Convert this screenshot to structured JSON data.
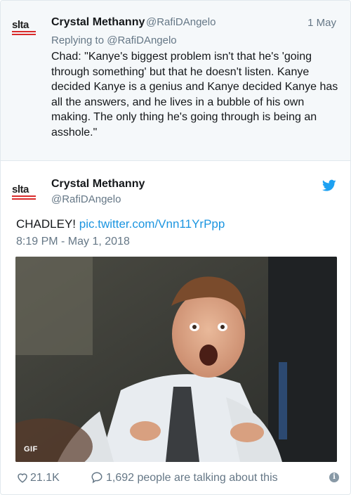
{
  "parent_tweet": {
    "avatar_text": "slta",
    "name": "Crystal Methanny",
    "handle": "@RafiDAngelo",
    "date": "1 May",
    "replying_to": "Replying to @RafiDAngelo",
    "text": "Chad: \"Kanye's biggest problem isn't that he's 'going through something' but that he doesn't listen. Kanye decided Kanye is a genius and Kanye decided Kanye has all the answers, and he lives in a bubble of his own making. The only thing he's going through is being an asshole.\""
  },
  "main_tweet": {
    "avatar_text": "slta",
    "name": "Crystal Methanny",
    "handle": "@RafiDAngelo",
    "text": "CHADLEY!",
    "link": "pic.twitter.com/Vnn11YrPpp",
    "timestamp": "8:19 PM - May 1, 2018",
    "media_badge": "GIF",
    "bird_icon": "twitter-bird-icon"
  },
  "footer": {
    "likes": "21.1K",
    "talking": "1,692 people are talking about this",
    "info_glyph": "i"
  },
  "colors": {
    "link": "#1b95e0",
    "muted": "#657786",
    "parent_bg": "#f5f8fa",
    "logo_red": "#d92b2b"
  }
}
